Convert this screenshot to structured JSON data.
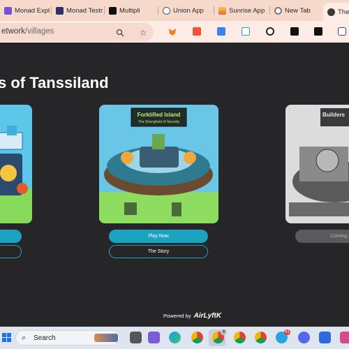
{
  "browser": {
    "tabs": [
      {
        "title": "Monad Expl",
        "favicon_color": "#7b4fd8"
      },
      {
        "title": "Monad Testr",
        "favicon_color": "#2f2f6a"
      },
      {
        "title": "Multipli",
        "favicon_color": "#111111"
      },
      {
        "title": "Union App",
        "favicon_color": "#555555"
      },
      {
        "title": "Sunrise App",
        "favicon_color": "#f29e3f"
      },
      {
        "title": "New Tab",
        "favicon_color": "#777777"
      },
      {
        "title": "The",
        "favicon_color": "#3a3a3a"
      }
    ],
    "address": {
      "host_fragment": "etwork",
      "path": "/villages"
    },
    "extensions": [
      {
        "name": "metamask-extension-icon",
        "color": "#e8831e"
      },
      {
        "name": "p-extension-icon",
        "color": "#f0533a"
      },
      {
        "name": "k-extension-icon",
        "color": "#3b82f6"
      },
      {
        "name": "shield-extension-icon",
        "color": "#1e9be9"
      },
      {
        "name": "w-extension-icon",
        "color": "#222222"
      },
      {
        "name": "arrow-extension-icon",
        "color": "#111111"
      },
      {
        "name": "x-extension-icon",
        "color": "#111111"
      },
      {
        "name": "puzzle-extension-icon",
        "color": "#555555"
      }
    ]
  },
  "page": {
    "title": "s of Tanssiland",
    "cards": [
      {
        "name": "left-village",
        "play_label": "",
        "story_label": ""
      },
      {
        "name": "Forktified Island",
        "subtitle": "The Stronghold of Security",
        "play_label": "Play Now",
        "story_label": "The Story"
      },
      {
        "name": "Builders",
        "subtitle": "",
        "coming_label": "Coming S"
      }
    ],
    "footer": {
      "powered_label": "Powered by",
      "brand": "AirLyftK"
    }
  },
  "taskbar": {
    "search_label": "Search",
    "badges": {
      "chrome_2": "9",
      "telegram": "41"
    },
    "accent": "#1a73e8"
  }
}
